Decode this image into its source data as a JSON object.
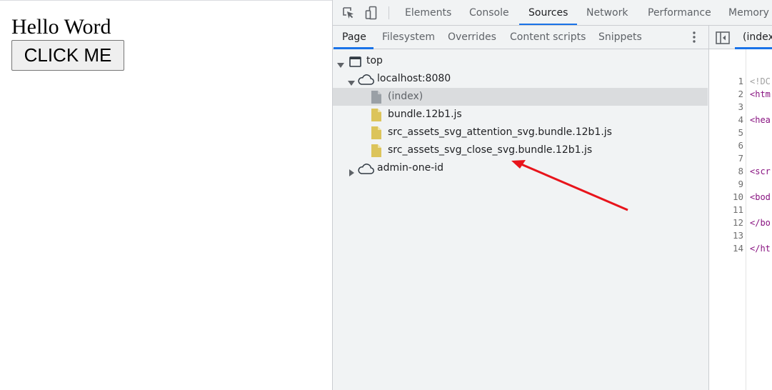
{
  "page": {
    "heading": "Hello Word",
    "button_label": "CLICK ME"
  },
  "devtools": {
    "main_tabs": [
      {
        "label": "Elements"
      },
      {
        "label": "Console"
      },
      {
        "label": "Sources",
        "active": true
      },
      {
        "label": "Network"
      },
      {
        "label": "Performance"
      },
      {
        "label": "Memory"
      }
    ],
    "toolbar_icons": [
      "inspect-element-icon",
      "device-toggle-icon"
    ],
    "navigator": {
      "tabs": [
        {
          "label": "Page",
          "active": true
        },
        {
          "label": "Filesystem"
        },
        {
          "label": "Overrides"
        },
        {
          "label": "Content scripts"
        },
        {
          "label": "Snippets"
        }
      ],
      "more_icon": "more-vertical-icon",
      "tree": [
        {
          "label": "top",
          "icon": "frame-icon",
          "expanded": true
        },
        {
          "label": "localhost:8080",
          "icon": "cloud-icon",
          "expanded": true
        },
        {
          "label": "(index)",
          "icon": "document-icon",
          "selected": true
        },
        {
          "label": "bundle.12b1.js",
          "icon": "script-file-icon"
        },
        {
          "label": "src_assets_svg_attention_svg.bundle.12b1.js",
          "icon": "script-file-icon"
        },
        {
          "label": "src_assets_svg_close_svg.bundle.12b1.js",
          "icon": "script-file-icon"
        },
        {
          "label": "admin-one-id",
          "icon": "cloud-icon",
          "expanded": false
        }
      ]
    },
    "editor": {
      "tab_label": "(index)",
      "lines": [
        {
          "n": "1",
          "code": "<!DC"
        },
        {
          "n": "2",
          "code": "<htm"
        },
        {
          "n": "3",
          "code": ""
        },
        {
          "n": "4",
          "code": "<hea"
        },
        {
          "n": "5",
          "code": ""
        },
        {
          "n": "6",
          "code": ""
        },
        {
          "n": "7",
          "code": ""
        },
        {
          "n": "8",
          "code": "<scr"
        },
        {
          "n": "9",
          "code": ""
        },
        {
          "n": "10",
          "code": "<bod"
        },
        {
          "n": "11",
          "code": ""
        },
        {
          "n": "12",
          "code": "</bo"
        },
        {
          "n": "13",
          "code": ""
        },
        {
          "n": "14",
          "code": "</ht"
        }
      ]
    }
  },
  "colors": {
    "accent": "#1a73e8",
    "annotation_arrow": "#e8141b",
    "script_icon": "#dcc45b",
    "document_icon": "#9aa0a6"
  }
}
